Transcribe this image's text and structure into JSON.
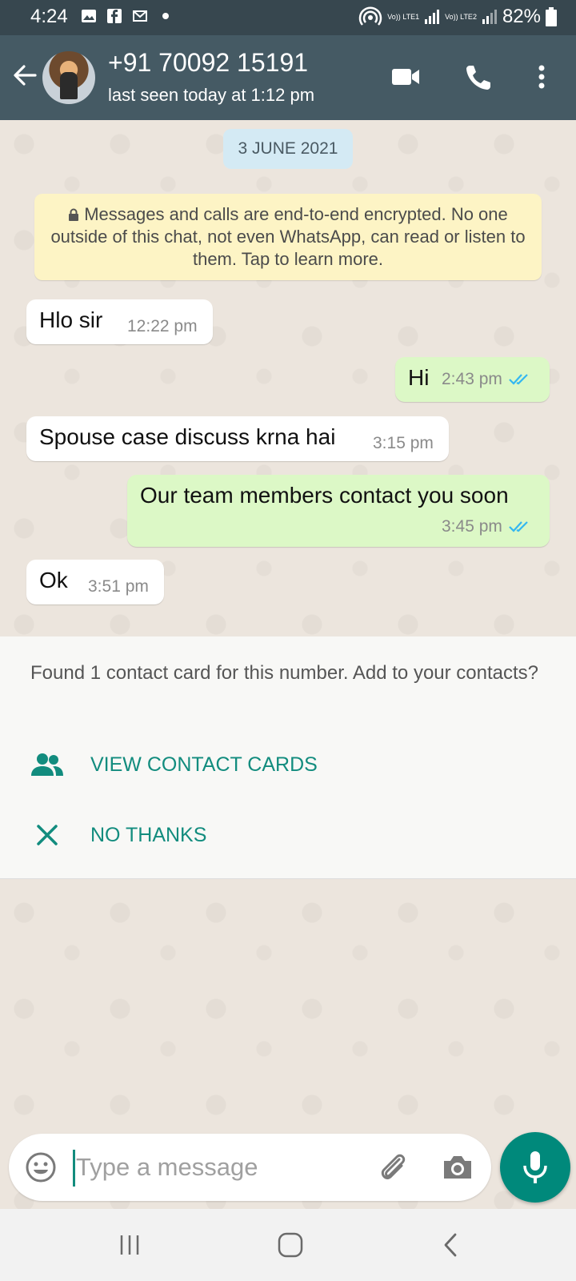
{
  "status_bar": {
    "time": "4:24",
    "battery": "82%",
    "sim1_label": "Vo)) LTE1",
    "sim2_label": "Vo)) LTE2",
    "icons": [
      "gallery-icon",
      "facebook-icon",
      "gmail-icon",
      "dot-icon",
      "hotspot-icon",
      "signal-icon",
      "battery-icon"
    ]
  },
  "header": {
    "contact_name": "+91 70092 15191",
    "last_seen": "last seen today at 1:12 pm",
    "icons": [
      "back-arrow-icon",
      "video-call-icon",
      "voice-call-icon",
      "more-options-icon"
    ]
  },
  "chat": {
    "date_chip": "3 JUNE 2021",
    "encryption_notice": "Messages and calls are end-to-end encrypted. No one outside of this chat, not even WhatsApp, can read or listen to them. Tap to learn more.",
    "messages": [
      {
        "direction": "incoming",
        "text": "Hlo sir",
        "time": "12:22 pm"
      },
      {
        "direction": "outgoing",
        "text": "Hi",
        "time": "2:43 pm",
        "status": "read"
      },
      {
        "direction": "incoming",
        "text": "Spouse case discuss krna hai",
        "time": "3:15 pm"
      },
      {
        "direction": "outgoing",
        "text": "Our team members contact you soon",
        "time": "3:45 pm",
        "status": "read"
      },
      {
        "direction": "incoming",
        "text": "Ok",
        "time": "3:51 pm"
      }
    ]
  },
  "contact_card_panel": {
    "info": "Found 1 contact card for this number. Add to your contacts?",
    "view_label": "VIEW CONTACT CARDS",
    "dismiss_label": "NO THANKS"
  },
  "composer": {
    "placeholder": "Type a message",
    "icons": [
      "emoji-icon",
      "attach-icon",
      "camera-icon",
      "mic-icon"
    ]
  },
  "nav_bar": {
    "icons": [
      "recent-apps-icon",
      "home-icon",
      "back-icon"
    ]
  },
  "colors": {
    "header": "#455a64",
    "status_bar": "#37474f",
    "accent": "#128c7e",
    "outgoing_bubble": "#dcf8c6",
    "incoming_bubble": "#ffffff",
    "read_ticks": "#34b7f1",
    "encryption_bg": "#fdf4c5"
  }
}
